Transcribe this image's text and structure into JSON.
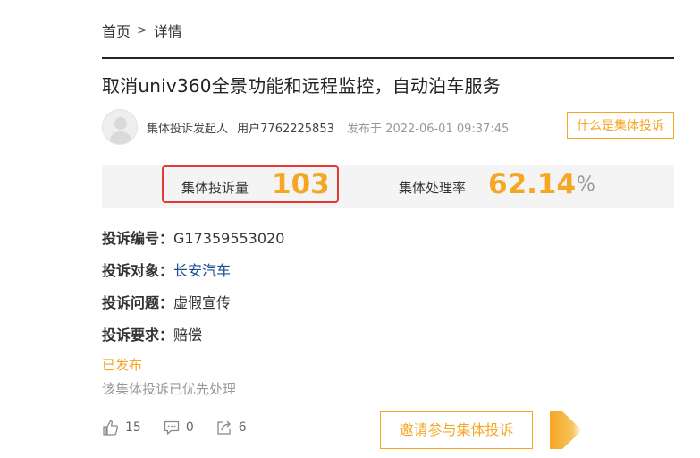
{
  "breadcrumb": {
    "home": "首页",
    "separator": ">",
    "current": "详情"
  },
  "title": "取消univ360全景功能和远程监控，自动泊车服务",
  "author": {
    "role": "集体投诉发起人",
    "user": "用户7762225853",
    "published_label": "发布于",
    "published_time": "2022-06-01 09:37:45"
  },
  "what_button": "什么是集体投诉",
  "stats": {
    "volume_label": "集体投诉量",
    "volume_value": "103",
    "rate_label": "集体处理率",
    "rate_value": "62.14",
    "rate_unit": "%"
  },
  "details": {
    "number_key": "投诉编号：",
    "number_value": "G17359553020",
    "target_key": "投诉对象：",
    "target_value": "长安汽车",
    "issue_key": "投诉问题：",
    "issue_value": "虚假宣传",
    "request_key": "投诉要求：",
    "request_value": "赔偿"
  },
  "status": {
    "label": "已发布",
    "note": "该集体投诉已优先处理"
  },
  "actions": {
    "likes": "15",
    "comments": "0",
    "shares": "6"
  },
  "invite_button": "邀请参与集体投诉",
  "colors": {
    "accent": "#f5a623",
    "highlight_border": "#e53935",
    "link": "#1f4e8c"
  },
  "icons": [
    "avatar-placeholder-icon",
    "thumbs-up-icon",
    "comment-icon",
    "share-icon",
    "orange-arrow-icon"
  ]
}
